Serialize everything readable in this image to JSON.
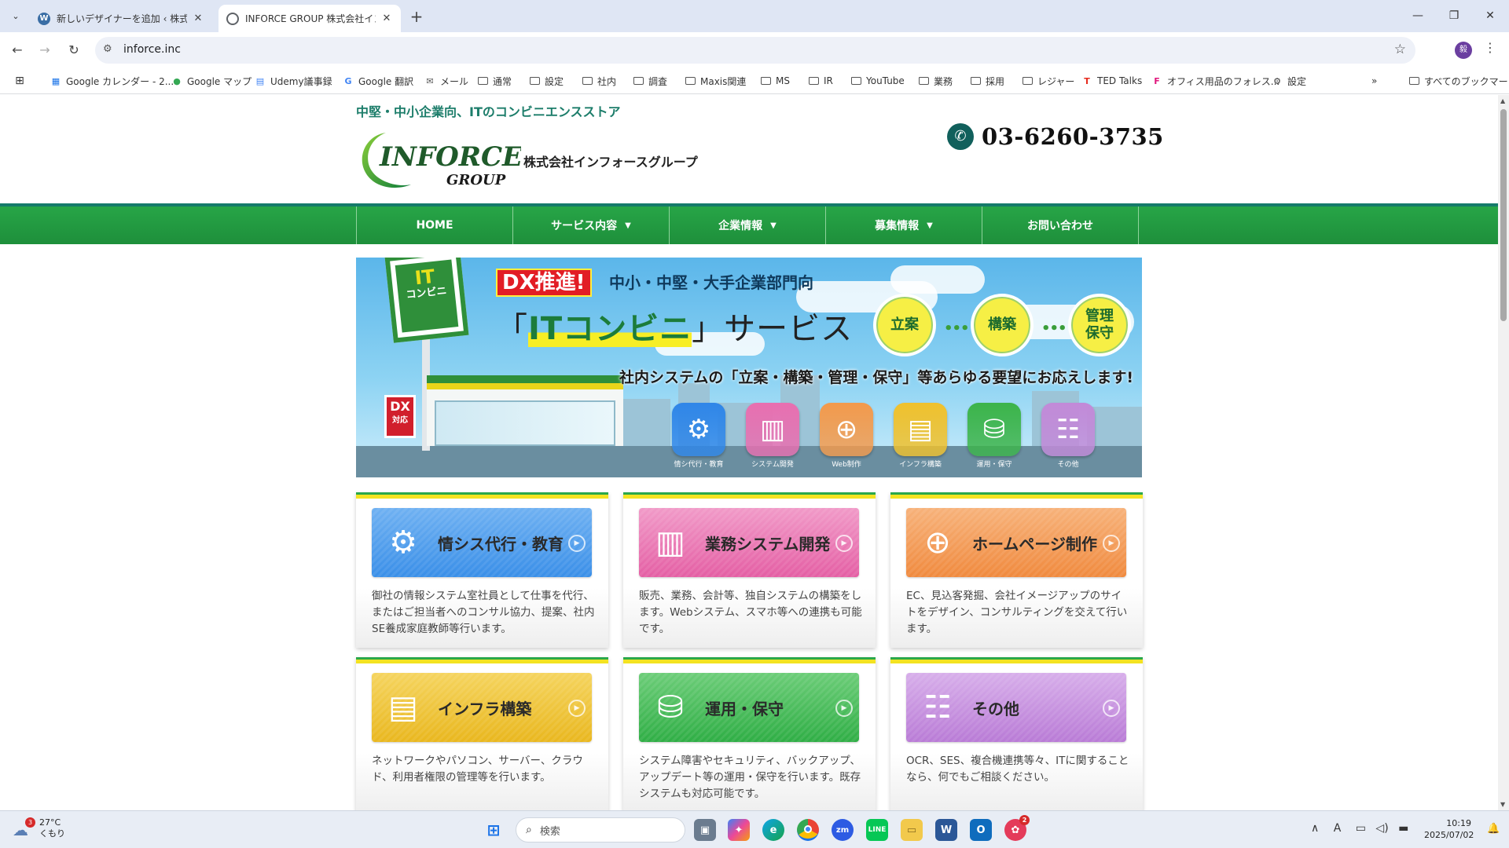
{
  "browser": {
    "tabs": [
      {
        "title": "新しいデザイナーを追加 ‹ 株式会社",
        "close": "✕"
      },
      {
        "title": "INFORCE GROUP 株式会社インフ",
        "close": "✕"
      }
    ],
    "new_tab": "+",
    "url": "inforce.inc",
    "profile_initial": "毅",
    "bookmarks": [
      {
        "label": "Google カレンダー - 2...",
        "icon": "calendar-icon",
        "color": "#1a73e8"
      },
      {
        "label": "Google マップ",
        "icon": "map-pin-icon",
        "color": "#34a853"
      },
      {
        "label": "Udemy議事録",
        "icon": "doc-icon",
        "color": "#4285f4"
      },
      {
        "label": "Google 翻訳",
        "icon": "translate-icon",
        "color": "#4285f4"
      },
      {
        "label": "メール",
        "icon": "mail-icon",
        "color": "#555555"
      },
      {
        "label": "通常",
        "icon": "folder-icon"
      },
      {
        "label": "設定",
        "icon": "folder-icon"
      },
      {
        "label": "社内",
        "icon": "folder-icon"
      },
      {
        "label": "調査",
        "icon": "folder-icon"
      },
      {
        "label": "Maxis関連",
        "icon": "folder-icon"
      },
      {
        "label": "MS",
        "icon": "folder-icon"
      },
      {
        "label": "IR",
        "icon": "folder-icon"
      },
      {
        "label": "YouTube",
        "icon": "folder-icon"
      },
      {
        "label": "業務",
        "icon": "folder-icon"
      },
      {
        "label": "採用",
        "icon": "folder-icon"
      },
      {
        "label": "レジャー",
        "icon": "folder-icon"
      },
      {
        "label": "TED Talks",
        "icon": "ted-icon",
        "color": "#e62b1e"
      },
      {
        "label": "オフィス用品のフォレス...",
        "icon": "forest-icon",
        "color": "#e0177c"
      },
      {
        "label": "設定",
        "icon": "gear-icon"
      }
    ],
    "overflow": "»",
    "all_bookmarks": "すべてのブックマーク"
  },
  "site": {
    "tagline": "中堅・中小企業向、ITのコンビニエンスストア",
    "logo_text": "INFORCE",
    "logo_sub": "GROUP",
    "company_name": "株式会社インフォースグループ",
    "phone": "03-6260-3735",
    "nav": [
      {
        "label": "HOME",
        "dropdown": false
      },
      {
        "label": "サービス内容",
        "dropdown": true
      },
      {
        "label": "企業情報",
        "dropdown": true
      },
      {
        "label": "募集情報",
        "dropdown": true
      },
      {
        "label": "お問い合わせ",
        "dropdown": false
      }
    ],
    "hero": {
      "sign_it": "IT",
      "sign_text": "コンビニ",
      "dx_sign": "DX",
      "dx_sign_sub": "対応",
      "badge": "DX推進!",
      "sub": "中小・中堅・大手企業部門向",
      "title_open": "「",
      "title_highlight": "ITコンビニ",
      "title_close": "」サービス",
      "steps": [
        "立案",
        "構築",
        "管理\n保守"
      ],
      "message": "社内システムの「立案・構築・管理・保守」等あらゆる要望にお応えします!",
      "icons": [
        {
          "label": "情シ代行・教育",
          "color": "#2f86e8",
          "glyph": "⚙"
        },
        {
          "label": "システム開発",
          "color": "#e86fb0",
          "glyph": "▥"
        },
        {
          "label": "Web制作",
          "color": "#f39a4c",
          "glyph": "⊕"
        },
        {
          "label": "インフラ構築",
          "color": "#f0c12c",
          "glyph": "▤"
        },
        {
          "label": "運用・保守",
          "color": "#3cb44a",
          "glyph": "⛁"
        },
        {
          "label": "その他",
          "color": "#c28ad8",
          "glyph": "☷"
        }
      ]
    },
    "cards": [
      {
        "title": "情シス代行・教育",
        "desc": "御社の情報システム室社員として仕事を代行、またはご担当者へのコンサル協力、提案、社内SE養成家庭教師等行います。",
        "color": "#3a8fe8",
        "color2": "#6fb1f2",
        "glyph": "⚙"
      },
      {
        "title": "業務システム開発",
        "desc": "販売、業務、会計等、独自システムの構築をします。Webシステム、スマホ等への連携も可能です。",
        "color": "#e45fa4",
        "color2": "#f19ac8",
        "glyph": "▥"
      },
      {
        "title": "ホームページ制作",
        "desc": "EC、見込客発掘、会社イメージアップのサイトをデザイン、コンサルティングを交えて行います。",
        "color": "#f08a3e",
        "color2": "#f7b27a",
        "glyph": "⊕"
      },
      {
        "title": "インフラ構築",
        "desc": "ネットワークやパソコン、サーバー、クラウド、利用者権限の管理等を行います。",
        "color": "#e9b71e",
        "color2": "#f5d45e",
        "glyph": "▤"
      },
      {
        "title": "運用・保守",
        "desc": "システム障害やセキュリティ、バックアップ、アップデート等の運用・保守を行います。既存システムも対応可能です。",
        "color": "#2fae45",
        "color2": "#6ccd78",
        "glyph": "⛁"
      },
      {
        "title": "その他",
        "desc": "OCR、SES、複合機連携等々、ITに関することなら、何でもご相談ください。",
        "color": "#b97bd6",
        "color2": "#d7aeea",
        "glyph": "☷"
      }
    ]
  },
  "taskbar": {
    "weather_temp": "27°C",
    "weather_desc": "くもり",
    "weather_badge": "3",
    "search_placeholder": "検索",
    "clock_time": "10:19",
    "clock_date": "2025/07/02",
    "tray_ime": "A",
    "app_badge": "2"
  }
}
